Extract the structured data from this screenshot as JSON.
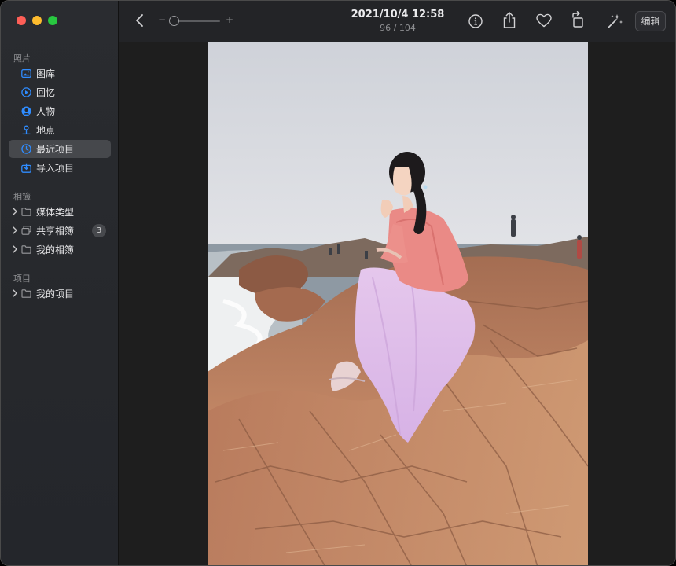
{
  "window": {
    "controls": [
      "close-button",
      "minimize-button",
      "zoom-button"
    ]
  },
  "sidebar": {
    "sections": [
      {
        "title": "照片"
      },
      {
        "title": "相簿"
      },
      {
        "title": "项目"
      }
    ],
    "photos_items": [
      {
        "label": "图库",
        "icon": "photo-library-icon"
      },
      {
        "label": "回忆",
        "icon": "memories-icon"
      },
      {
        "label": "人物",
        "icon": "people-icon"
      },
      {
        "label": "地点",
        "icon": "places-pin-icon"
      },
      {
        "label": "最近项目",
        "icon": "recents-clock-icon",
        "selected": true
      },
      {
        "label": "导入项目",
        "icon": "imports-icon"
      }
    ],
    "album_items": [
      {
        "label": "媒体类型",
        "icon": "folder-icon"
      },
      {
        "label": "共享相簿",
        "icon": "shared-albums-icon",
        "badge": "3"
      },
      {
        "label": "我的相簿",
        "icon": "folder-icon"
      }
    ],
    "project_items": [
      {
        "label": "我的项目",
        "icon": "folder-icon"
      }
    ]
  },
  "toolbar": {
    "back_icon": "chevron-left-icon",
    "zoom_minus": "−",
    "zoom_plus": "+",
    "zoom_level": 0.0,
    "title": "2021/10/4 12:58",
    "subtitle": "96 / 104",
    "actions": [
      "info-icon",
      "share-icon",
      "favorite-heart-icon",
      "rotate-icon",
      "auto-enhance-wand-icon"
    ],
    "edit_label": "编辑"
  },
  "colors": {
    "accent": "#0a84ff",
    "sidebar_bg": "#27292d",
    "selection": "#46484c",
    "toolbar_bg": "#232427",
    "content_bg": "#1e1e1e"
  },
  "photo": {
    "description_icon": "beach-portrait-photo"
  }
}
